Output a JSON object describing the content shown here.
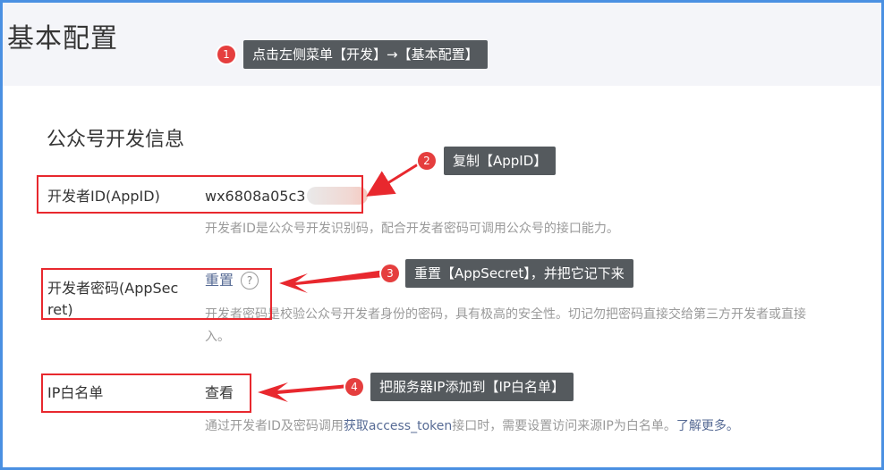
{
  "page": {
    "title": "基本配置"
  },
  "section": {
    "title": "公众号开发信息"
  },
  "rows": {
    "appid": {
      "label": "开发者ID(AppID)",
      "value": "wx6808a05c3",
      "desc": "开发者ID是公众号开发识别码，配合开发者密码可调用公众号的接口能力。"
    },
    "appsecret": {
      "label_line1": "开发者密码(AppSec",
      "label_line2": "ret)",
      "action": "重置",
      "help": "?",
      "desc_line1": "开发者密码是校验公众号开发者身份的密码，具有极高的安全性。切记勿把密码直接交给第三方开发者或直接",
      "desc_line2": "入。"
    },
    "ipwhitelist": {
      "label": "IP白名单",
      "action": "查看",
      "desc_prefix": "通过开发者ID及密码调用",
      "desc_link": "获取access_token",
      "desc_mid": "接口时，需要设置访问来源IP为白名单。",
      "desc_more": "了解更多。"
    }
  },
  "annotations": [
    {
      "num": "1",
      "text": "点击左侧菜单【开发】→【基本配置】"
    },
    {
      "num": "2",
      "text": "复制【AppID】"
    },
    {
      "num": "3",
      "text": "重置【AppSecret】，并把它记下来"
    },
    {
      "num": "4",
      "text": "把服务器IP添加到【IP白名单】"
    }
  ],
  "colors": {
    "accent_red": "#e8282e",
    "frame_blue": "#4a90e2",
    "link": "#576b95",
    "callout_bg": "#555a5e"
  }
}
